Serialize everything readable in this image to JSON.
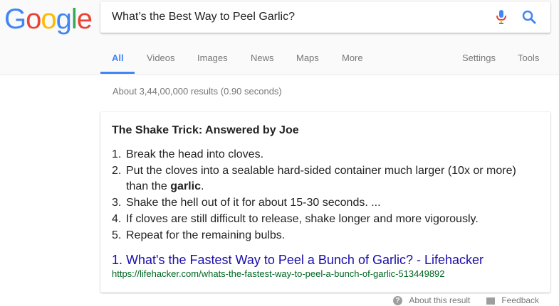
{
  "logo": {
    "letters": [
      "G",
      "o",
      "o",
      "g",
      "l",
      "e"
    ],
    "colors": [
      "#4285f4",
      "#ea4335",
      "#fbbc05",
      "#4285f4",
      "#34a853",
      "#ea4335"
    ]
  },
  "search": {
    "query": "What’s the Best Way to Peel Garlic?"
  },
  "icons": {
    "mic": "microphone-icon",
    "search": "search-icon",
    "about": "help-icon",
    "feedback": "feedback-icon"
  },
  "tabs": {
    "all": "All",
    "videos": "Videos",
    "images": "Images",
    "news": "News",
    "maps": "Maps",
    "more": "More",
    "settings": "Settings",
    "tools": "Tools"
  },
  "stats": "About 3,44,00,000 results (0.90 seconds)",
  "snippet": {
    "heading": "The Shake Trick: Answered by Joe",
    "steps": [
      {
        "num": "1.",
        "text": "Break the head into cloves."
      },
      {
        "num": "2.",
        "text_a": "Put the cloves into a sealable hard-sided container much larger (10x or more)",
        "text_b": "than the ",
        "bold": "garlic",
        "tail": "."
      },
      {
        "num": "3.",
        "text": "Shake the hell out of it for about 15-30 seconds. ..."
      },
      {
        "num": "4.",
        "text": "If cloves are still difficult to release, shake longer and more vigorously."
      },
      {
        "num": "5.",
        "text": "Repeat for the remaining bulbs."
      }
    ],
    "result_num": "1.",
    "result_title": "What's the Fastest Way to Peel a Bunch of Garlic? - Lifehacker",
    "result_url": "https://lifehacker.com/whats-the-fastest-way-to-peel-a-bunch-of-garlic-513449892"
  },
  "footer": {
    "about": "About this result",
    "feedback": "Feedback"
  }
}
